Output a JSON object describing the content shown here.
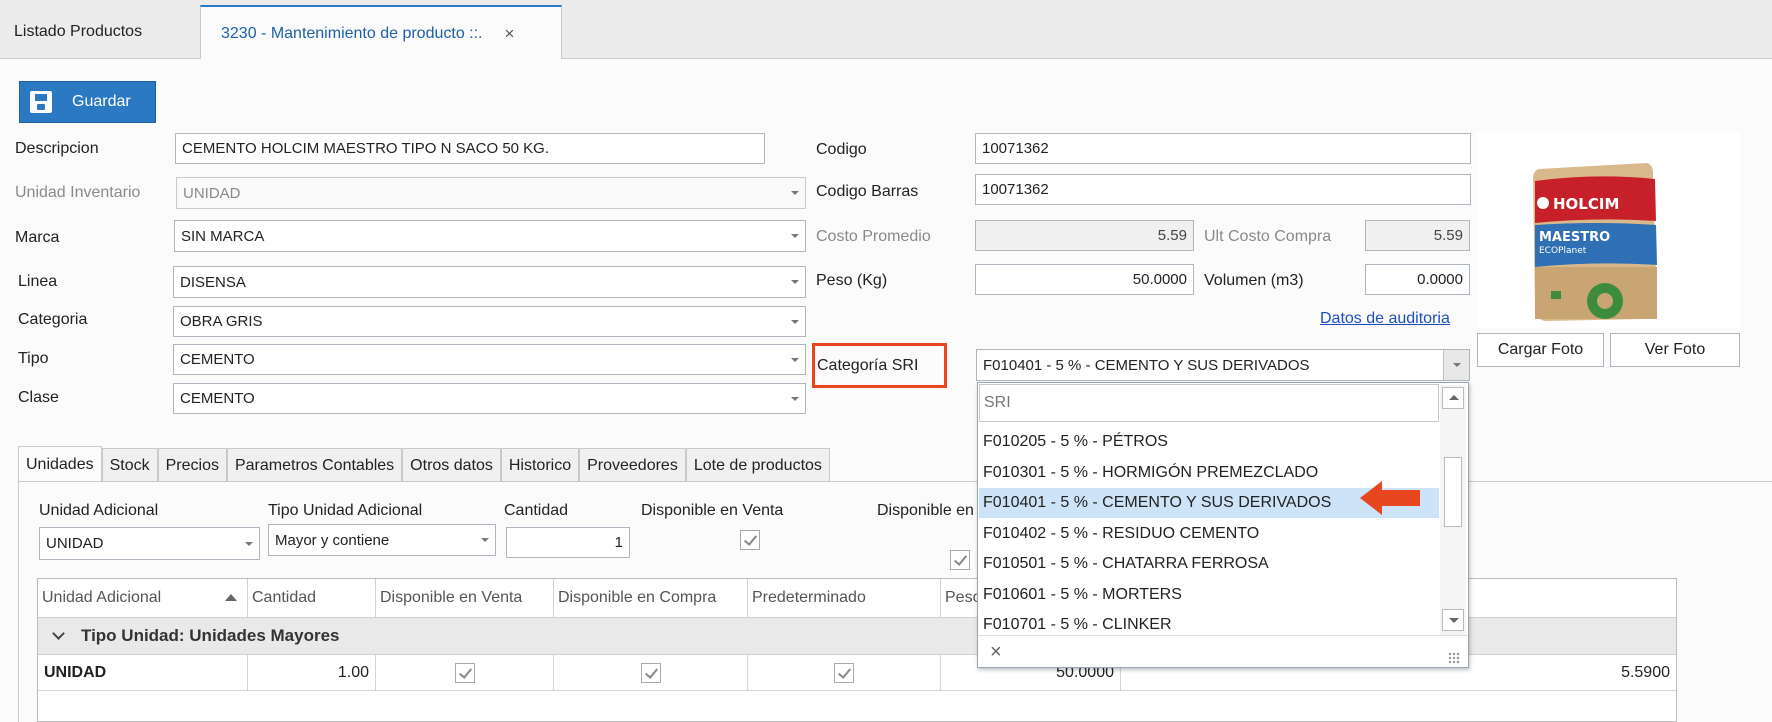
{
  "tabs": {
    "list": "Listado Productos",
    "active": "3230 - Mantenimiento de producto ::.",
    "close": "×"
  },
  "toolbar": {
    "save_label": "Guardar"
  },
  "form": {
    "descripcion_label": "Descripcion",
    "descripcion_value": "CEMENTO HOLCIM MAESTRO TIPO N SACO 50 KG.",
    "unidad_label": "Unidad Inventario",
    "unidad_value": "UNIDAD",
    "marca_label": "Marca",
    "marca_value": "SIN MARCA",
    "linea_label": "Linea",
    "linea_value": "DISENSA",
    "categoria_label": "Categoria",
    "categoria_value": "OBRA GRIS",
    "tipo_label": "Tipo",
    "tipo_value": "CEMENTO",
    "clase_label": "Clase",
    "clase_value": "CEMENTO",
    "codigo_label": "Codigo",
    "codigo_value": "10071362",
    "codigo_barras_label": "Codigo Barras",
    "codigo_barras_value": "10071362",
    "costo_promedio_label": "Costo Promedio",
    "costo_promedio_value": "5.59",
    "ult_costo_label": "Ult Costo Compra",
    "ult_costo_value": "5.59",
    "peso_label": "Peso (Kg)",
    "peso_value": "50.0000",
    "volumen_label": "Volumen (m3)",
    "volumen_value": "0.0000",
    "auditoria_link": "Datos de auditoria",
    "categoria_sri_label": "Categoría SRI",
    "categoria_sri_value": "F010401 - 5 % - CEMENTO Y SUS DERIVADOS"
  },
  "photo": {
    "brand": "HOLCIM",
    "product_line1": "MAESTRO",
    "product_line2": "ECOPlanet",
    "cargar": "Cargar Foto",
    "ver": "Ver Foto"
  },
  "dropdown": {
    "search": "SRI",
    "items": [
      "F010205 - 5 % - PÉTROS",
      "F010301 - 5 % - HORMIGÓN PREMEZCLADO",
      "F010401 - 5 % - CEMENTO Y SUS DERIVADOS",
      "F010402 - 5 % - RESIDUO CEMENTO",
      "F010501 - 5 % - CHATARRA FERROSA",
      "F010601 - 5 % - MORTERS",
      "F010701 - 5 % - CLINKER"
    ],
    "selected_index": 2,
    "close": "×",
    "accent": "#e8461e"
  },
  "lower_tabs": [
    "Unidades",
    "Stock",
    "Precios",
    "Parametros Contables",
    "Otros datos",
    "Historico",
    "Proveedores",
    "Lote de productos"
  ],
  "unit_form": {
    "unidad_adicional_label": "Unidad Adicional",
    "unidad_adicional_value": "UNIDAD",
    "tipo_label": "Tipo Unidad Adicional",
    "tipo_value": "Mayor y contiene",
    "cantidad_label": "Cantidad",
    "cantidad_value": "1",
    "disp_venta_label": "Disponible en Venta",
    "disp_compra_label": "Disponible en"
  },
  "grid": {
    "headers": [
      "Unidad Adicional",
      "Cantidad",
      "Disponible en Venta",
      "Disponible en Compra",
      "Predeterminado",
      "Peso"
    ],
    "group_label": "Tipo Unidad: Unidades Mayores",
    "row": {
      "unidad": "UNIDAD",
      "cantidad": "1.00",
      "peso": "50.0000",
      "costo": "5.5900"
    }
  }
}
